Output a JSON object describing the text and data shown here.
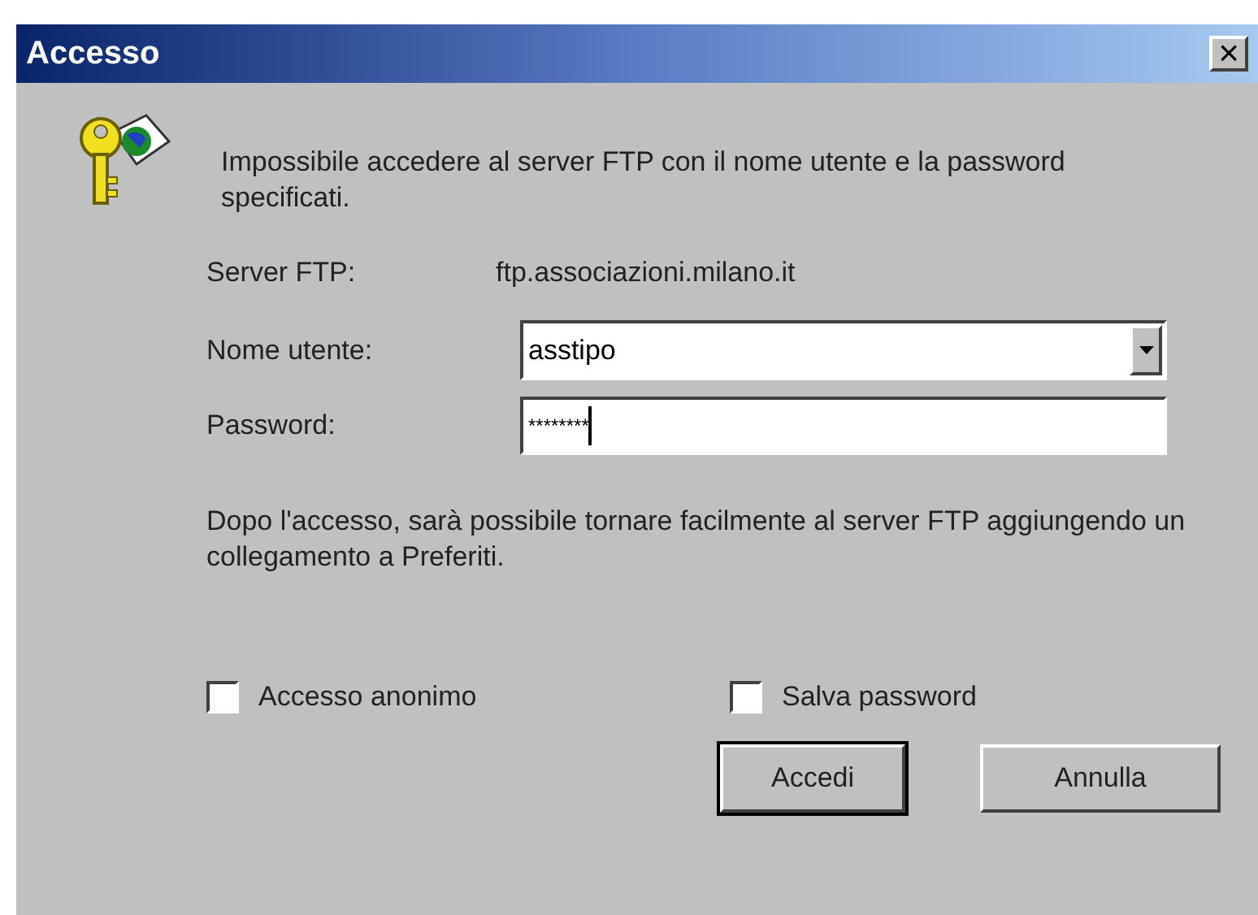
{
  "window": {
    "title": "Accesso",
    "close": "×"
  },
  "message": "Impossibile accedere al server FTP con il nome utente e la password specificati.",
  "server": {
    "label": "Server FTP:",
    "value": "ftp.associazioni.milano.it"
  },
  "username": {
    "label": "Nome utente:",
    "value": "asstipo"
  },
  "password": {
    "label": "Password:",
    "value": "********"
  },
  "note": "Dopo l'accesso, sarà possibile tornare facilmente al server FTP aggiungendo un collegamento a Preferiti.",
  "checkboxes": [
    {
      "label": "Accesso anonimo",
      "checked": false
    },
    {
      "label": "Salva password",
      "checked": false
    }
  ],
  "buttons": [
    {
      "label": "Accedi",
      "default": true
    },
    {
      "label": "Annulla",
      "default": false
    }
  ]
}
